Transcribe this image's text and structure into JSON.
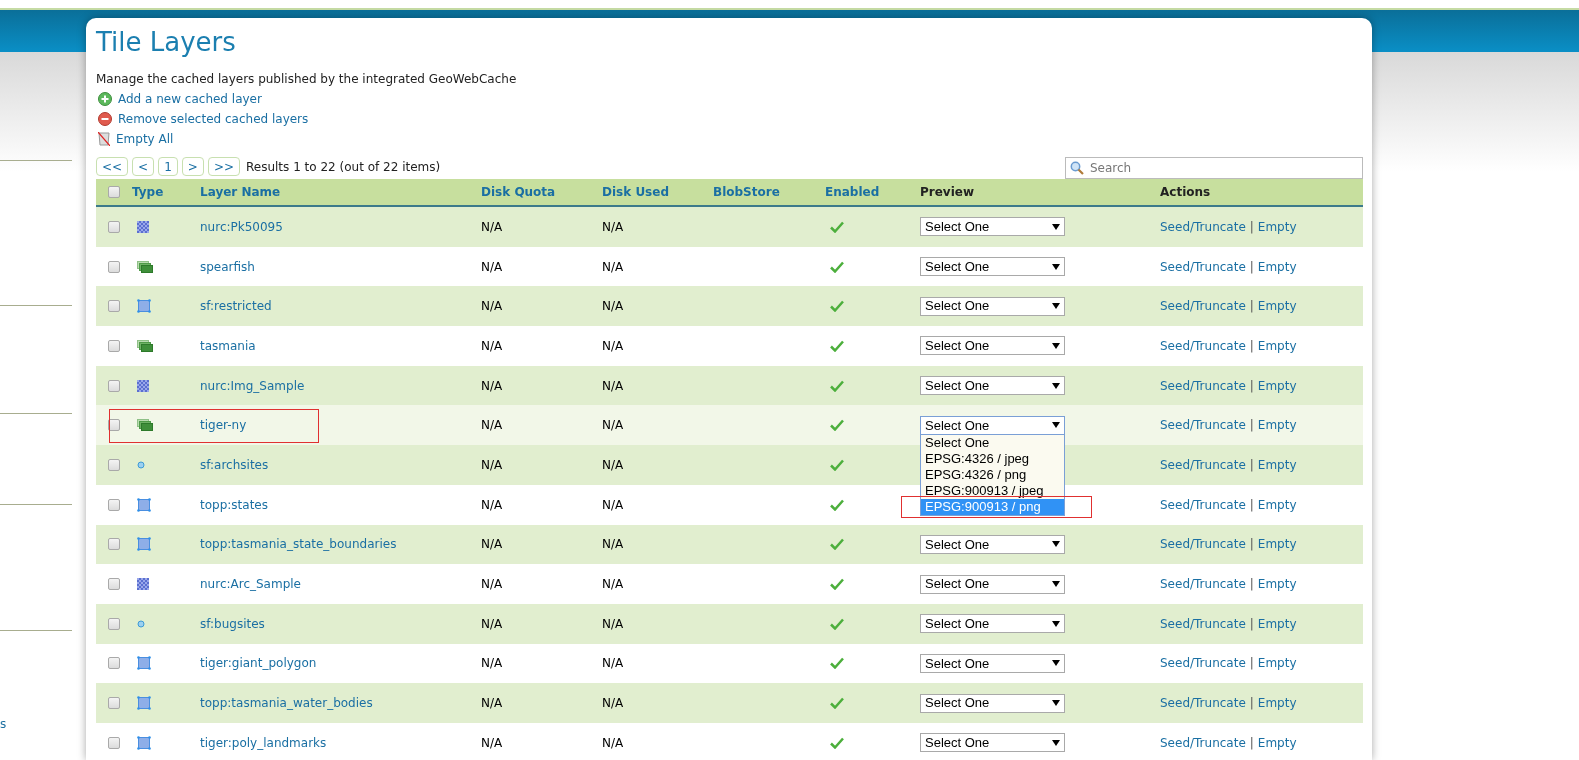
{
  "sidebar": {
    "text": "s"
  },
  "page": {
    "title": "Tile Layers",
    "description": "Manage the cached layers published by the integrated GeoWebCache",
    "actions": [
      {
        "kind": "add",
        "label": "Add a new cached layer"
      },
      {
        "kind": "remove",
        "label": "Remove selected cached layers"
      },
      {
        "kind": "empty",
        "label": "Empty All"
      }
    ]
  },
  "pager": {
    "buttons": [
      "<<",
      "<",
      "1",
      ">",
      ">>"
    ],
    "summary": "Results 1 to 22 (out of 22 items)"
  },
  "search": {
    "placeholder": "Search"
  },
  "table": {
    "all_checked": false,
    "columns": [
      "Type",
      "Layer Name",
      "Disk Quota",
      "Disk Used",
      "BlobStore",
      "Enabled",
      "Preview",
      "Actions"
    ],
    "rows": [
      {
        "checked": false,
        "kind": "raster",
        "name": "nurc:Pk50095",
        "quota": "N/A",
        "used": "N/A",
        "enabled": true,
        "preview": "Select One",
        "seed": "Seed/Truncate",
        "sep": "|",
        "empty": "Empty",
        "hovered": false,
        "annotated": false
      },
      {
        "checked": false,
        "kind": "group",
        "name": "spearfish",
        "quota": "N/A",
        "used": "N/A",
        "enabled": true,
        "preview": "Select One",
        "seed": "Seed/Truncate",
        "sep": "|",
        "empty": "Empty",
        "hovered": false,
        "annotated": false
      },
      {
        "checked": false,
        "kind": "polygon",
        "name": "sf:restricted",
        "quota": "N/A",
        "used": "N/A",
        "enabled": true,
        "preview": "Select One",
        "seed": "Seed/Truncate",
        "sep": "|",
        "empty": "Empty",
        "hovered": false,
        "annotated": false
      },
      {
        "checked": false,
        "kind": "group",
        "name": "tasmania",
        "quota": "N/A",
        "used": "N/A",
        "enabled": true,
        "preview": "Select One",
        "seed": "Seed/Truncate",
        "sep": "|",
        "empty": "Empty",
        "hovered": false,
        "annotated": false
      },
      {
        "checked": false,
        "kind": "raster",
        "name": "nurc:Img_Sample",
        "quota": "N/A",
        "used": "N/A",
        "enabled": true,
        "preview": "Select One",
        "seed": "Seed/Truncate",
        "sep": "|",
        "empty": "Empty",
        "hovered": false,
        "annotated": false
      },
      {
        "checked": false,
        "kind": "group",
        "name": "tiger-ny",
        "quota": "N/A",
        "used": "N/A",
        "enabled": true,
        "preview": "Select One",
        "seed": "Seed/Truncate",
        "sep": "|",
        "empty": "Empty",
        "hovered": true,
        "annotated": true,
        "options": [
          {
            "label": "Select One",
            "selected": false,
            "annotated": false
          },
          {
            "label": "EPSG:4326 / jpeg",
            "selected": false,
            "annotated": false
          },
          {
            "label": "EPSG:4326 / png",
            "selected": false,
            "annotated": false
          },
          {
            "label": "EPSG:900913 / jpeg",
            "selected": false,
            "annotated": false
          },
          {
            "label": "EPSG:900913 / png",
            "selected": true,
            "annotated": true
          }
        ]
      },
      {
        "checked": false,
        "kind": "point",
        "name": "sf:archsites",
        "quota": "N/A",
        "used": "N/A",
        "enabled": true,
        "seed": "Seed/Truncate",
        "sep": "|",
        "empty": "Empty",
        "hovered": false,
        "annotated": false
      },
      {
        "checked": false,
        "kind": "polygon",
        "name": "topp:states",
        "quota": "N/A",
        "used": "N/A",
        "enabled": true,
        "seed": "Seed/Truncate",
        "sep": "|",
        "empty": "Empty",
        "hovered": false,
        "annotated": false
      },
      {
        "checked": false,
        "kind": "polygon",
        "name": "topp:tasmania_state_boundaries",
        "quota": "N/A",
        "used": "N/A",
        "enabled": true,
        "preview": "Select One",
        "seed": "Seed/Truncate",
        "sep": "|",
        "empty": "Empty",
        "hovered": false,
        "annotated": false
      },
      {
        "checked": false,
        "kind": "raster",
        "name": "nurc:Arc_Sample",
        "quota": "N/A",
        "used": "N/A",
        "enabled": true,
        "preview": "Select One",
        "seed": "Seed/Truncate",
        "sep": "|",
        "empty": "Empty",
        "hovered": false,
        "annotated": false
      },
      {
        "checked": false,
        "kind": "point",
        "name": "sf:bugsites",
        "quota": "N/A",
        "used": "N/A",
        "enabled": true,
        "preview": "Select One",
        "seed": "Seed/Truncate",
        "sep": "|",
        "empty": "Empty",
        "hovered": false,
        "annotated": false
      },
      {
        "checked": false,
        "kind": "polygon",
        "name": "tiger:giant_polygon",
        "quota": "N/A",
        "used": "N/A",
        "enabled": true,
        "preview": "Select One",
        "seed": "Seed/Truncate",
        "sep": "|",
        "empty": "Empty",
        "hovered": false,
        "annotated": false
      },
      {
        "checked": false,
        "kind": "polygon",
        "name": "topp:tasmania_water_bodies",
        "quota": "N/A",
        "used": "N/A",
        "enabled": true,
        "preview": "Select One",
        "seed": "Seed/Truncate",
        "sep": "|",
        "empty": "Empty",
        "hovered": false,
        "annotated": false
      },
      {
        "checked": false,
        "kind": "polygon",
        "name": "tiger:poly_landmarks",
        "quota": "N/A",
        "used": "N/A",
        "enabled": true,
        "preview": "Select One",
        "seed": "Seed/Truncate",
        "sep": "|",
        "empty": "Empty",
        "hovered": false,
        "annotated": false
      }
    ]
  }
}
